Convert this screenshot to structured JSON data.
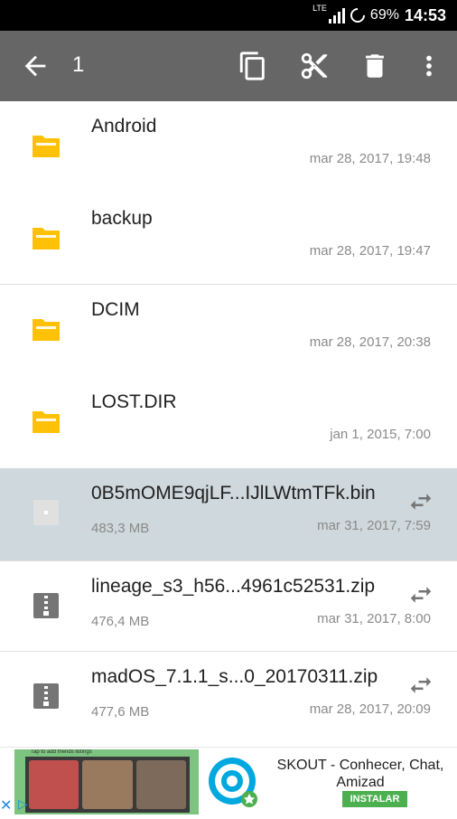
{
  "status_bar": {
    "network": "LTE",
    "battery": "69%",
    "time": "14:53"
  },
  "toolbar": {
    "selected_count": "1",
    "icons": [
      "back-arrow-icon",
      "copy-icon",
      "cut-icon",
      "delete-icon",
      "more-vert-icon"
    ]
  },
  "files": [
    {
      "name": "Android",
      "size": "",
      "date": "mar 28, 2017, 19:48",
      "type": "folder",
      "selected": false
    },
    {
      "name": "backup",
      "size": "",
      "date": "mar 28, 2017, 19:47",
      "type": "folder",
      "selected": false
    },
    {
      "name": "DCIM",
      "size": "",
      "date": "mar 28, 2017, 20:38",
      "type": "folder",
      "selected": false
    },
    {
      "name": "LOST.DIR",
      "size": "",
      "date": "jan 1, 2015, 7:00",
      "type": "folder",
      "selected": false
    },
    {
      "name": "0B5mOME9qjLF...IJlLWtmTFk.bin",
      "size": "483,3 MB",
      "date": "mar 31, 2017, 7:59",
      "type": "file",
      "selected": true
    },
    {
      "name": "lineage_s3_h56...4961c52531.zip",
      "size": "476,4 MB",
      "date": "mar 31, 2017, 8:00",
      "type": "zip",
      "selected": false
    },
    {
      "name": "madOS_7.1.1_s...0_20170311.zip",
      "size": "477,6 MB",
      "date": "mar 28, 2017, 20:09",
      "type": "zip",
      "selected": false
    }
  ],
  "ad": {
    "tagline": "Tap to add friends listings",
    "title": "SKOUT - Conhecer, Chat, Amizad",
    "button": "INSTALAR"
  },
  "colors": {
    "toolbar": "#666666",
    "folder": "#ffc107",
    "selected_row": "#cfd8dc",
    "install_button": "#4caf50"
  }
}
